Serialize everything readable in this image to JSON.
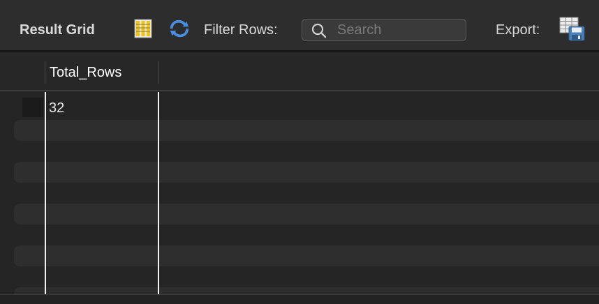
{
  "toolbar": {
    "title": "Result Grid",
    "filter_label": "Filter Rows:",
    "search_placeholder": "Search",
    "export_label": "Export:",
    "icons": {
      "grid_view": "column-toggle-icon",
      "refresh": "refresh-arrows-icon",
      "search": "magnifier-icon",
      "export": "export-grid-icon"
    }
  },
  "grid": {
    "columns": [
      "Total_Rows"
    ],
    "rows": [
      [
        "32"
      ]
    ]
  },
  "colors": {
    "accent_blue": "#4a8ee0",
    "toolbar_bg": "#2d2d2d",
    "grid_bg": "#252525"
  }
}
